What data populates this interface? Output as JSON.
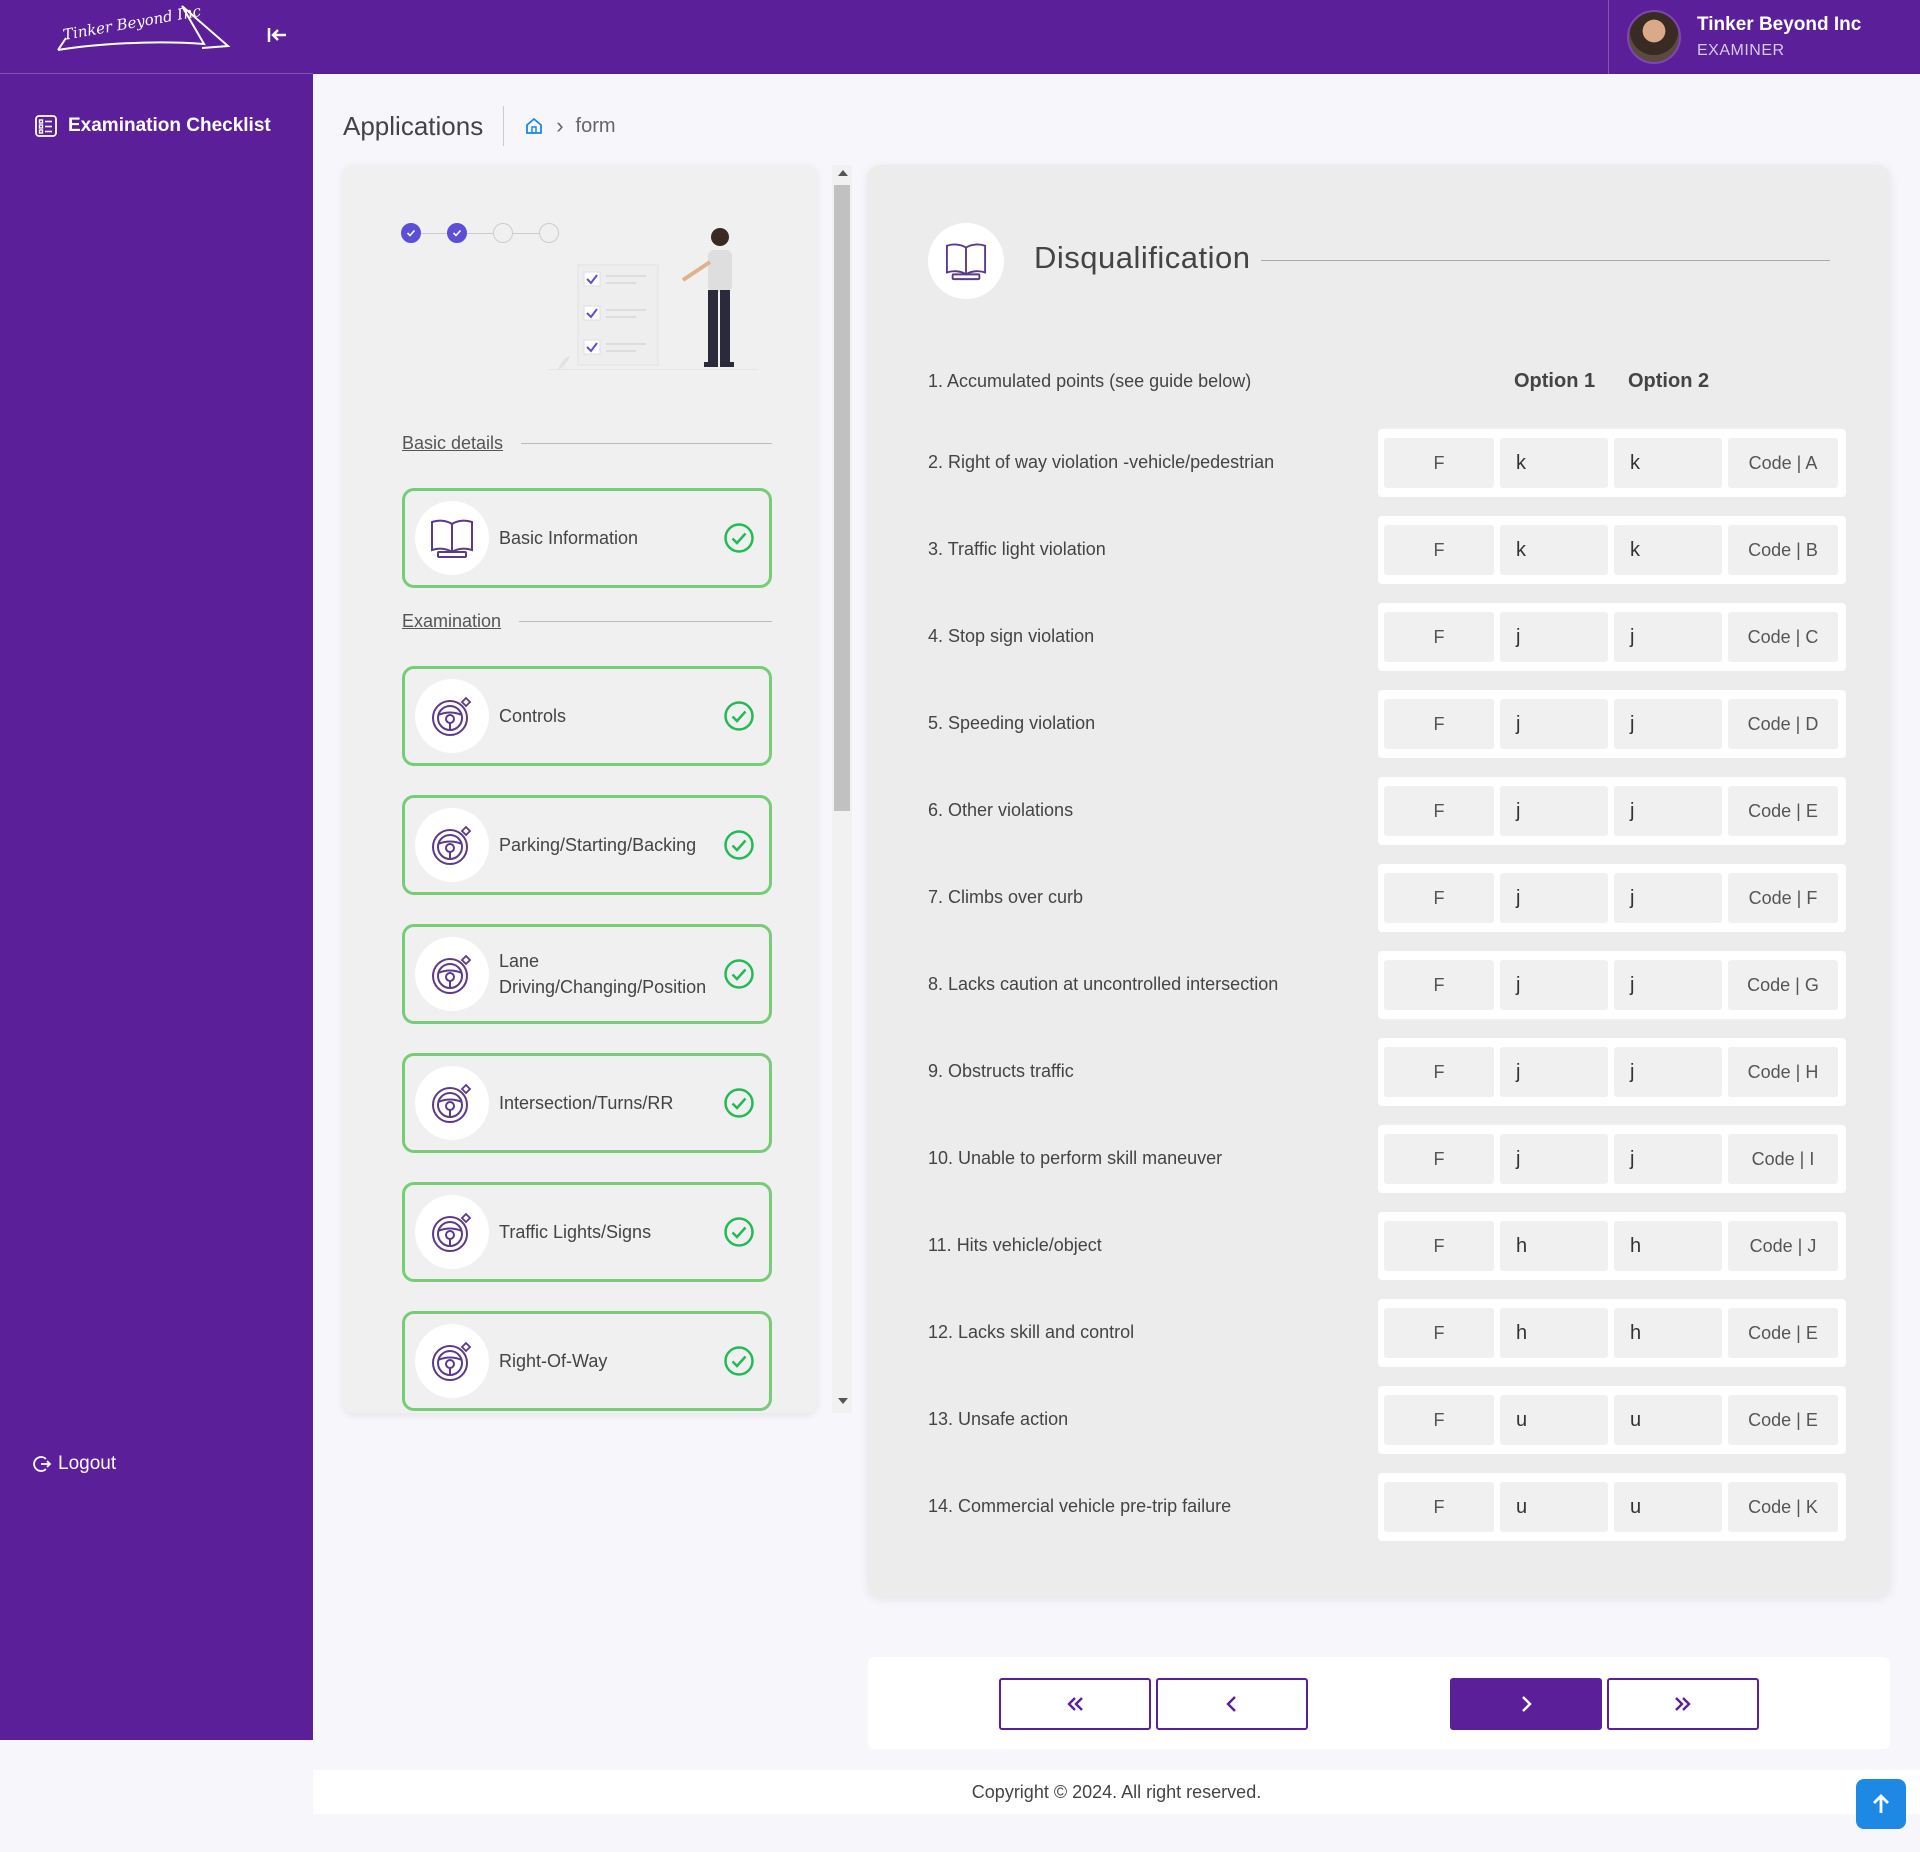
{
  "brand": {
    "logo_text": "Tinker Beyond Inc"
  },
  "sidebar": {
    "nav_label": "Examination Checklist",
    "logout_label": "Logout"
  },
  "user": {
    "name": "Tinker Beyond Inc",
    "role": "EXAMINER"
  },
  "breadcrumb": {
    "title": "Applications",
    "current": "form"
  },
  "stepper": {
    "progress": {
      "completed": 2,
      "total": 4
    },
    "sections": [
      {
        "label": "Basic details"
      },
      {
        "label": "Examination"
      }
    ],
    "steps": [
      {
        "label": "Basic Information",
        "icon": "book-icon",
        "status": "complete"
      },
      {
        "label": "Controls",
        "icon": "steering-wheel-icon",
        "status": "complete"
      },
      {
        "label": "Parking/Starting/Backing",
        "icon": "steering-wheel-icon",
        "status": "complete"
      },
      {
        "label": "Lane Driving/Changing/Position",
        "icon": "steering-wheel-icon",
        "status": "complete"
      },
      {
        "label": "Intersection/Turns/RR",
        "icon": "steering-wheel-icon",
        "status": "complete"
      },
      {
        "label": "Traffic Lights/Signs",
        "icon": "steering-wheel-icon",
        "status": "complete"
      },
      {
        "label": "Right-Of-Way",
        "icon": "steering-wheel-icon",
        "status": "complete"
      }
    ]
  },
  "form": {
    "title": "Disqualification",
    "icon": "book-icon",
    "option1_header": "Option 1",
    "option2_header": "Option 2",
    "intro": "1. Accumulated points (see guide below)",
    "rows": [
      {
        "label": "2. Right of way violation -vehicle/pedestrian",
        "f": "F",
        "opt1": "k",
        "opt2": "k",
        "code": "Code | A"
      },
      {
        "label": "3. Traffic light violation",
        "f": "F",
        "opt1": "k",
        "opt2": "k",
        "code": "Code | B"
      },
      {
        "label": "4. Stop sign violation",
        "f": "F",
        "opt1": "j",
        "opt2": "j",
        "code": "Code | C"
      },
      {
        "label": "5. Speeding violation",
        "f": "F",
        "opt1": "j",
        "opt2": "j",
        "code": "Code | D"
      },
      {
        "label": "6. Other violations",
        "f": "F",
        "opt1": "j",
        "opt2": "j",
        "code": "Code | E"
      },
      {
        "label": "7. Climbs over curb",
        "f": "F",
        "opt1": "j",
        "opt2": "j",
        "code": "Code | F"
      },
      {
        "label": "8. Lacks caution at uncontrolled intersection",
        "f": "F",
        "opt1": "j",
        "opt2": "j",
        "code": "Code | G"
      },
      {
        "label": "9. Obstructs traffic",
        "f": "F",
        "opt1": "j",
        "opt2": "j",
        "code": "Code | H"
      },
      {
        "label": "10. Unable to perform skill maneuver",
        "f": "F",
        "opt1": "j",
        "opt2": "j",
        "code": "Code | I"
      },
      {
        "label": "11. Hits vehicle/object",
        "f": "F",
        "opt1": "h",
        "opt2": "h",
        "code": "Code | J"
      },
      {
        "label": "12. Lacks skill and control",
        "f": "F",
        "opt1": "h",
        "opt2": "h",
        "code": "Code | E"
      },
      {
        "label": "13. Unsafe action",
        "f": "F",
        "opt1": "u",
        "opt2": "u",
        "code": "Code | E"
      },
      {
        "label": "14. Commercial vehicle pre-trip failure",
        "f": "F",
        "opt1": "u",
        "opt2": "u",
        "code": "Code | K"
      }
    ]
  },
  "pager": {
    "first_icon": "double-chevron-left-icon",
    "prev_icon": "chevron-left-icon",
    "next_icon": "chevron-right-icon",
    "last_icon": "double-chevron-right-icon"
  },
  "footer": {
    "copyright": "Copyright © 2024. All right reserved."
  },
  "colors": {
    "brand": "#5c1f9a",
    "success": "#22bb55",
    "accent": "#5b4fd8",
    "scroll_top": "#1e88e5"
  }
}
